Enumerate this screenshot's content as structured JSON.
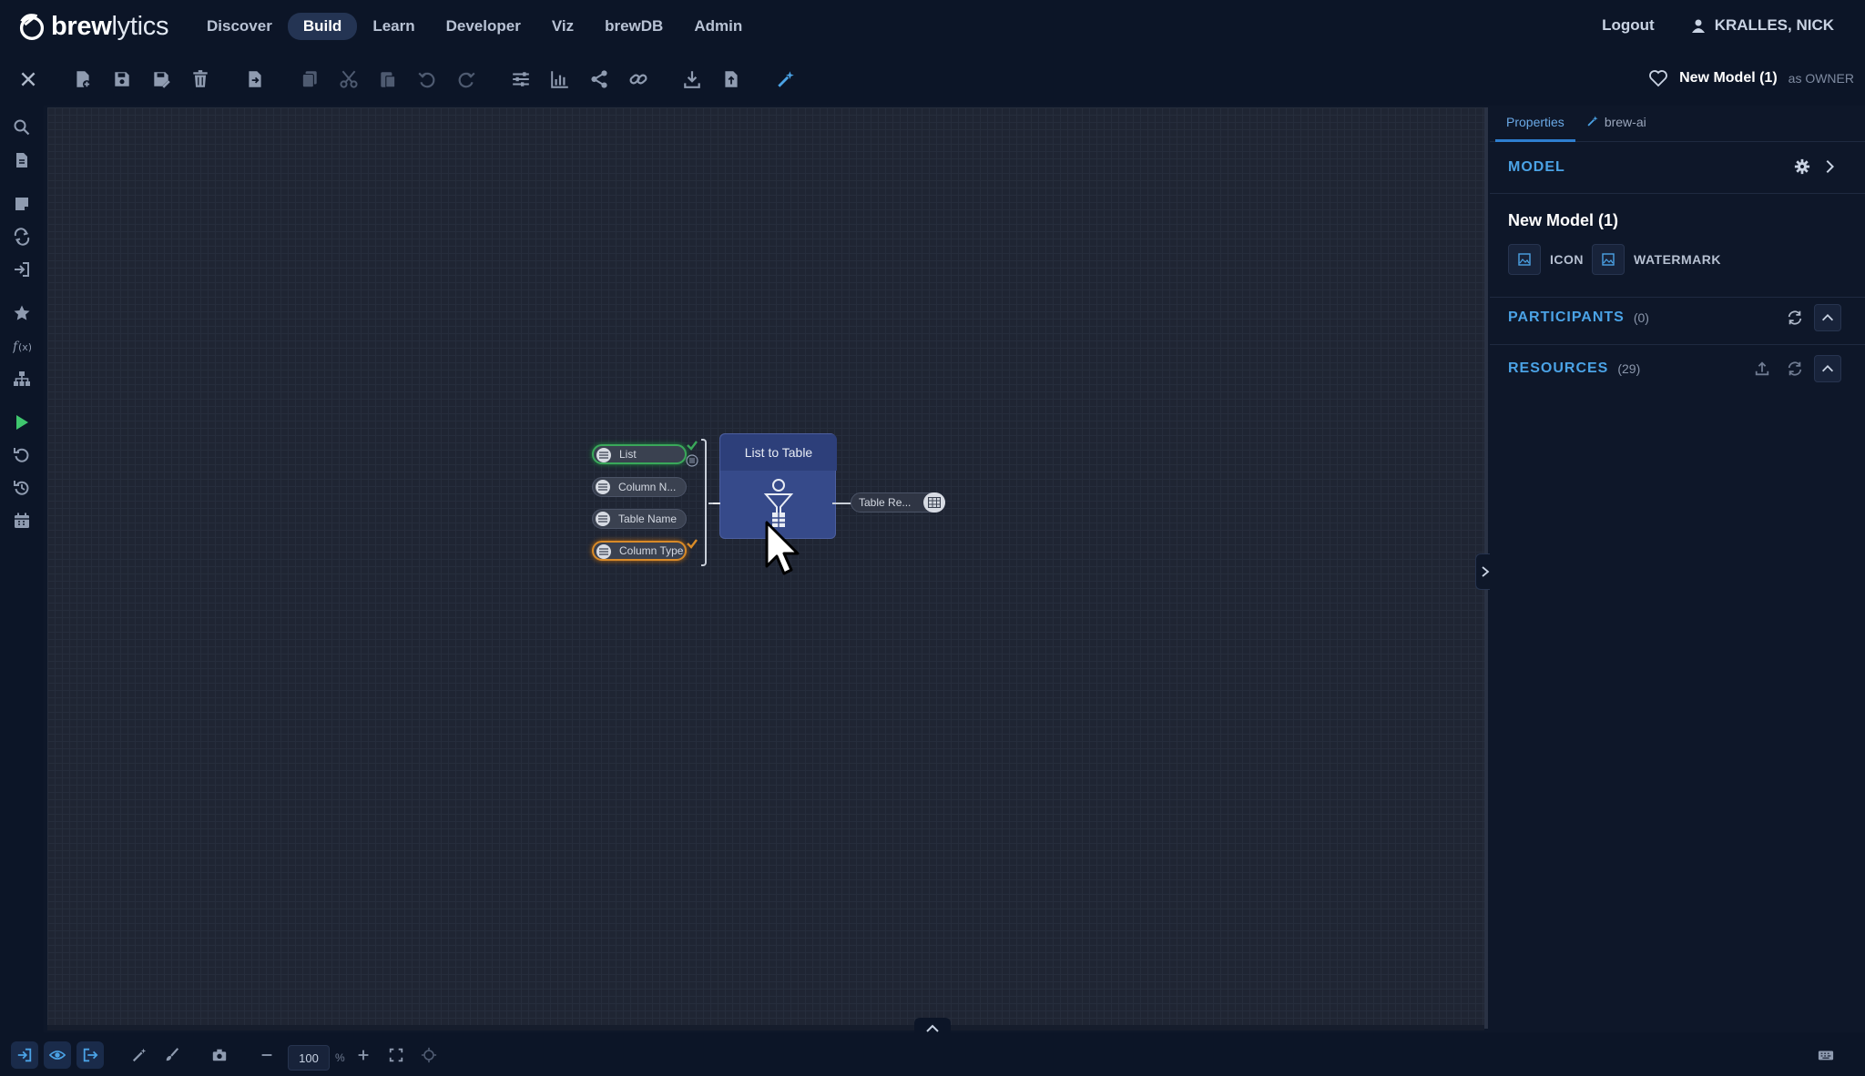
{
  "app": {
    "logo_bold": "brew",
    "logo_light": "lytics"
  },
  "nav": {
    "links": [
      "Discover",
      "Build",
      "Learn",
      "Developer",
      "Viz",
      "brewDB",
      "Admin"
    ],
    "active": "Build",
    "logout": "Logout",
    "user": "KRALLES, NICK"
  },
  "toolbar": {
    "model_name": "New Model (1)",
    "role": "as OWNER",
    "icons": [
      "close-icon",
      "new-file-icon",
      "save-icon",
      "save-as-icon",
      "delete-icon",
      "import-icon",
      "copy-icon",
      "cut-icon",
      "paste-icon",
      "undo-icon",
      "redo-icon",
      "sliders-icon",
      "chart-icon",
      "share-icon",
      "link-icon",
      "download-icon",
      "export-file-icon",
      "ai-wand-icon"
    ]
  },
  "left_rail": {
    "icons": [
      "search-icon",
      "document-icon",
      "note-icon",
      "loop-icon",
      "input-icon",
      "star-icon",
      "function-icon",
      "hierarchy-icon",
      "play-icon",
      "reset-icon",
      "history-icon",
      "calendar-icon"
    ]
  },
  "canvas": {
    "node": {
      "title": "List to Table",
      "inputs": [
        {
          "label": "List",
          "state": "valid"
        },
        {
          "label": "Column N...",
          "state": "default"
        },
        {
          "label": "Table Name",
          "state": "default"
        },
        {
          "label": "Column Type",
          "state": "warning"
        }
      ],
      "output": {
        "label": "Table Re..."
      }
    }
  },
  "panel": {
    "tabs": [
      {
        "label": "Properties",
        "active": true
      },
      {
        "label": "brew-ai",
        "active": false
      }
    ],
    "model_section": "MODEL",
    "model_name": "New Model (1)",
    "icon_label": "ICON",
    "watermark_label": "WATERMARK",
    "participants_label": "PARTICIPANTS",
    "participants_count": "(0)",
    "resources_label": "RESOURCES",
    "resources_count": "(29)"
  },
  "bottom": {
    "zoom": "100",
    "zoom_unit": "%"
  },
  "colors": {
    "accent": "#4ba3e6",
    "valid": "#3aa85a",
    "warning": "#d88a28",
    "node": "#364a8a"
  }
}
